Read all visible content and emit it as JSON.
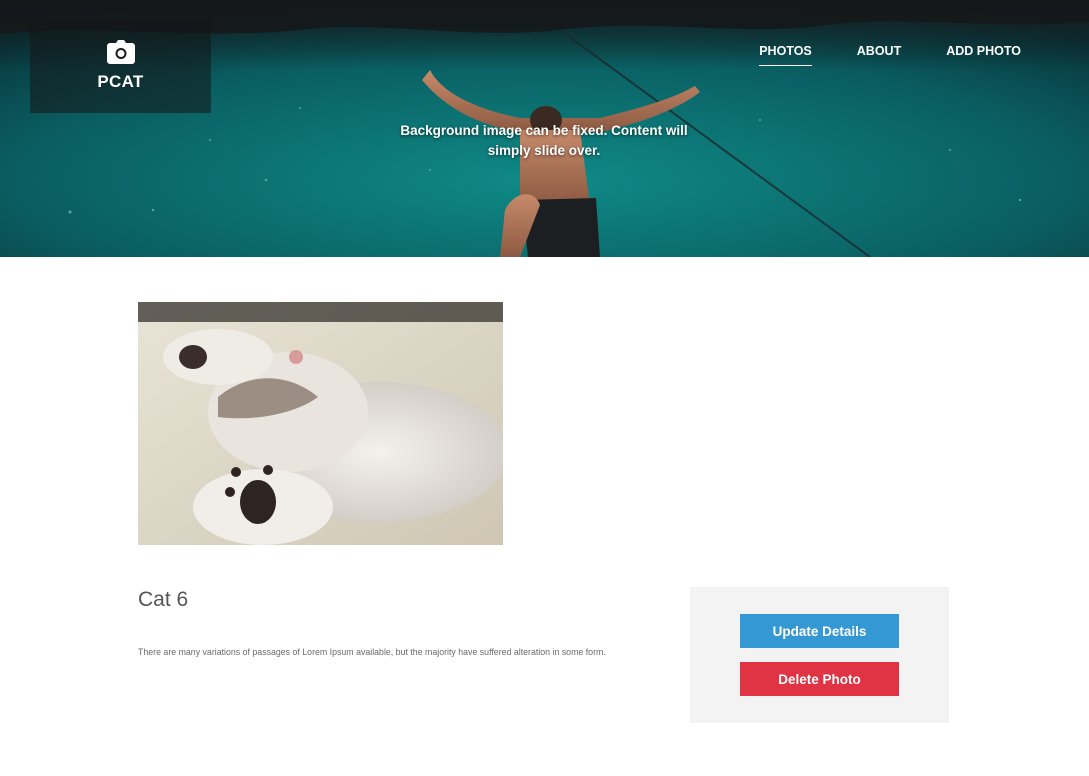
{
  "brand": {
    "name": "PCAT",
    "icon": "camera-icon"
  },
  "nav": {
    "items": [
      {
        "label": "PHOTOS",
        "active": true
      },
      {
        "label": "ABOUT",
        "active": false
      },
      {
        "label": "ADD PHOTO",
        "active": false
      }
    ]
  },
  "hero": {
    "caption": "Background image can be fixed. Content will simply slide over."
  },
  "photo": {
    "title": "Cat 6",
    "description": "There are many variations of passages of Lorem Ipsum available, but the majority have suffered alteration in some form."
  },
  "actions": {
    "update_label": "Update Details",
    "delete_label": "Delete Photo"
  },
  "colors": {
    "update_button": "#3498d4",
    "delete_button": "#e03444",
    "panel_bg": "#f3f3f3"
  }
}
